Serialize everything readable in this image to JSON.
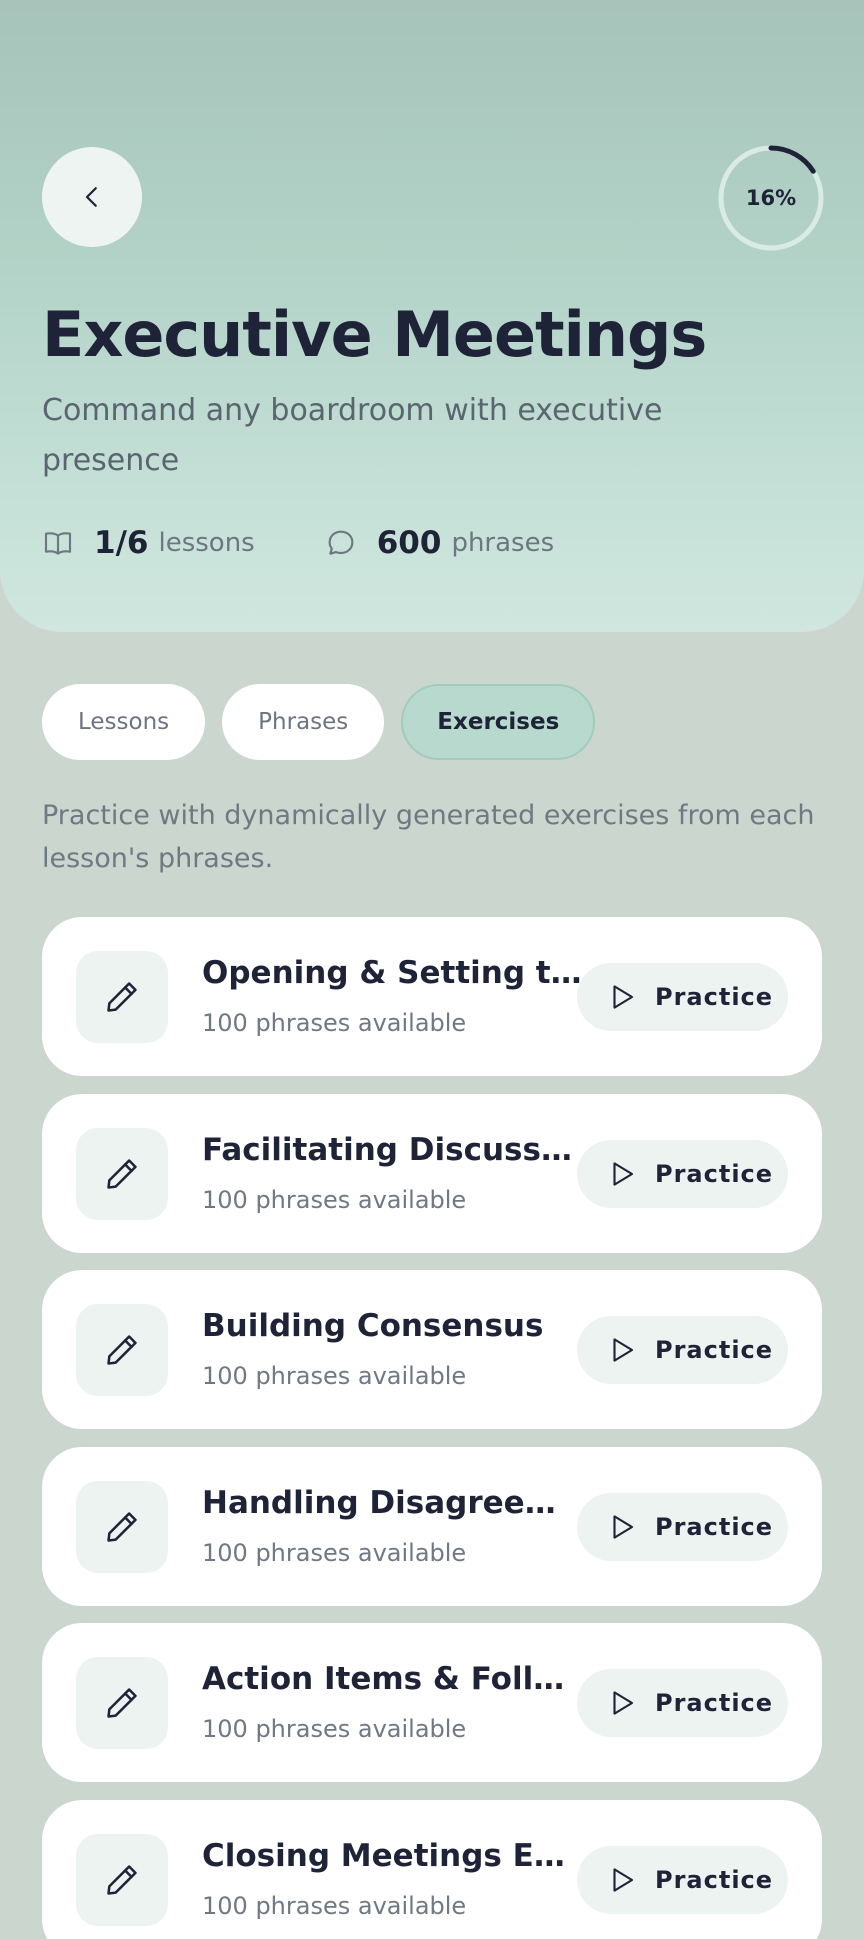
{
  "header": {
    "progress_text": "16%",
    "progress_value": 0.16,
    "title": "Executive Meetings",
    "subtitle": "Command any boardroom with executive presence",
    "lessons_count": "1/6",
    "lessons_unit": "lessons",
    "phrases_count": "600",
    "phrases_unit": "phrases"
  },
  "tabs": [
    {
      "label": "Lessons",
      "active": false
    },
    {
      "label": "Phrases",
      "active": false
    },
    {
      "label": "Exercises",
      "active": true
    }
  ],
  "description": "Practice with dynamically generated exercises from each lesson's phrases.",
  "practice_label": "Practice",
  "exercises": [
    {
      "title": "Opening & Setting th...",
      "subtitle": "100 phrases available"
    },
    {
      "title": "Facilitating Discussi...",
      "subtitle": "100 phrases available"
    },
    {
      "title": "Building Consensus",
      "subtitle": "100 phrases available"
    },
    {
      "title": "Handling Disagreem...",
      "subtitle": "100 phrases available"
    },
    {
      "title": "Action Items & Follo...",
      "subtitle": "100 phrases available"
    },
    {
      "title": "Closing Meetings Eff...",
      "subtitle": "100 phrases available"
    }
  ],
  "colors": {
    "accent": "#b8dace",
    "ring_track": "#d9ebe4",
    "ring_fill": "#1f2338",
    "text_dark": "#1f2338"
  },
  "icons": {
    "back": "chevron-left-icon",
    "lessons": "book-open-icon",
    "phrases": "speech-bubble-icon",
    "exercise": "pencil-icon",
    "practice": "play-icon"
  }
}
